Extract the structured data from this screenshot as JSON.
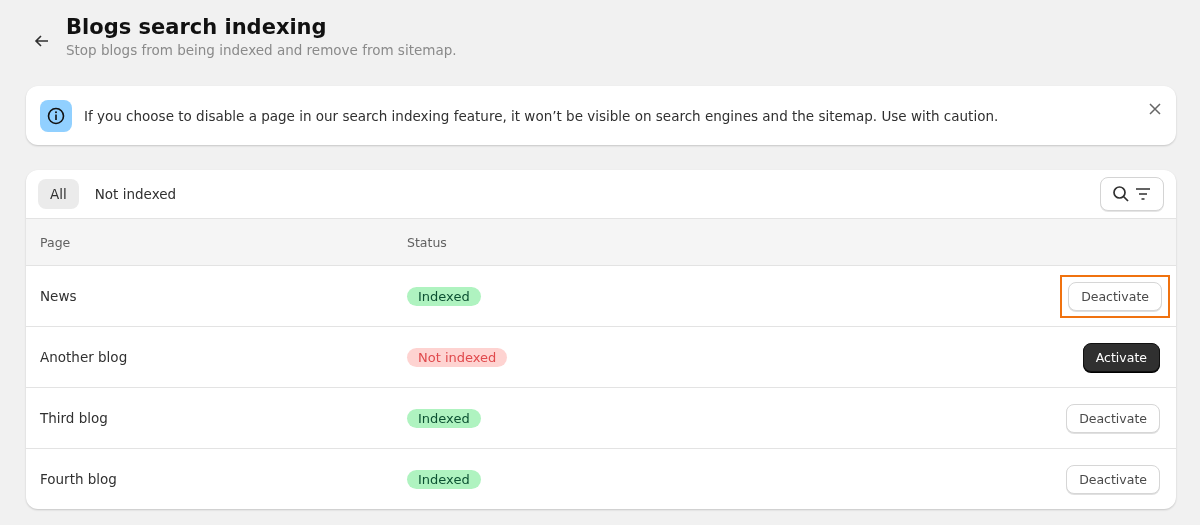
{
  "header": {
    "title": "Blogs search indexing",
    "subtitle": "Stop blogs from being indexed and remove from sitemap."
  },
  "banner": {
    "text": "If you choose to disable a page in our search indexing feature, it won’t be visible on search engines and the sitemap. Use with caution."
  },
  "tabs": [
    {
      "label": "All",
      "selected": true
    },
    {
      "label": "Not indexed",
      "selected": false
    }
  ],
  "table": {
    "columns": [
      "Page",
      "Status"
    ],
    "rows": [
      {
        "page": "News",
        "status": "Indexed",
        "indexed": true,
        "action": "Deactivate",
        "highlighted": true
      },
      {
        "page": "Another blog",
        "status": "Not indexed",
        "indexed": false,
        "action": "Activate",
        "highlighted": false
      },
      {
        "page": "Third blog",
        "status": "Indexed",
        "indexed": true,
        "action": "Deactivate",
        "highlighted": false
      },
      {
        "page": "Fourth blog",
        "status": "Indexed",
        "indexed": true,
        "action": "Deactivate",
        "highlighted": false
      }
    ]
  }
}
